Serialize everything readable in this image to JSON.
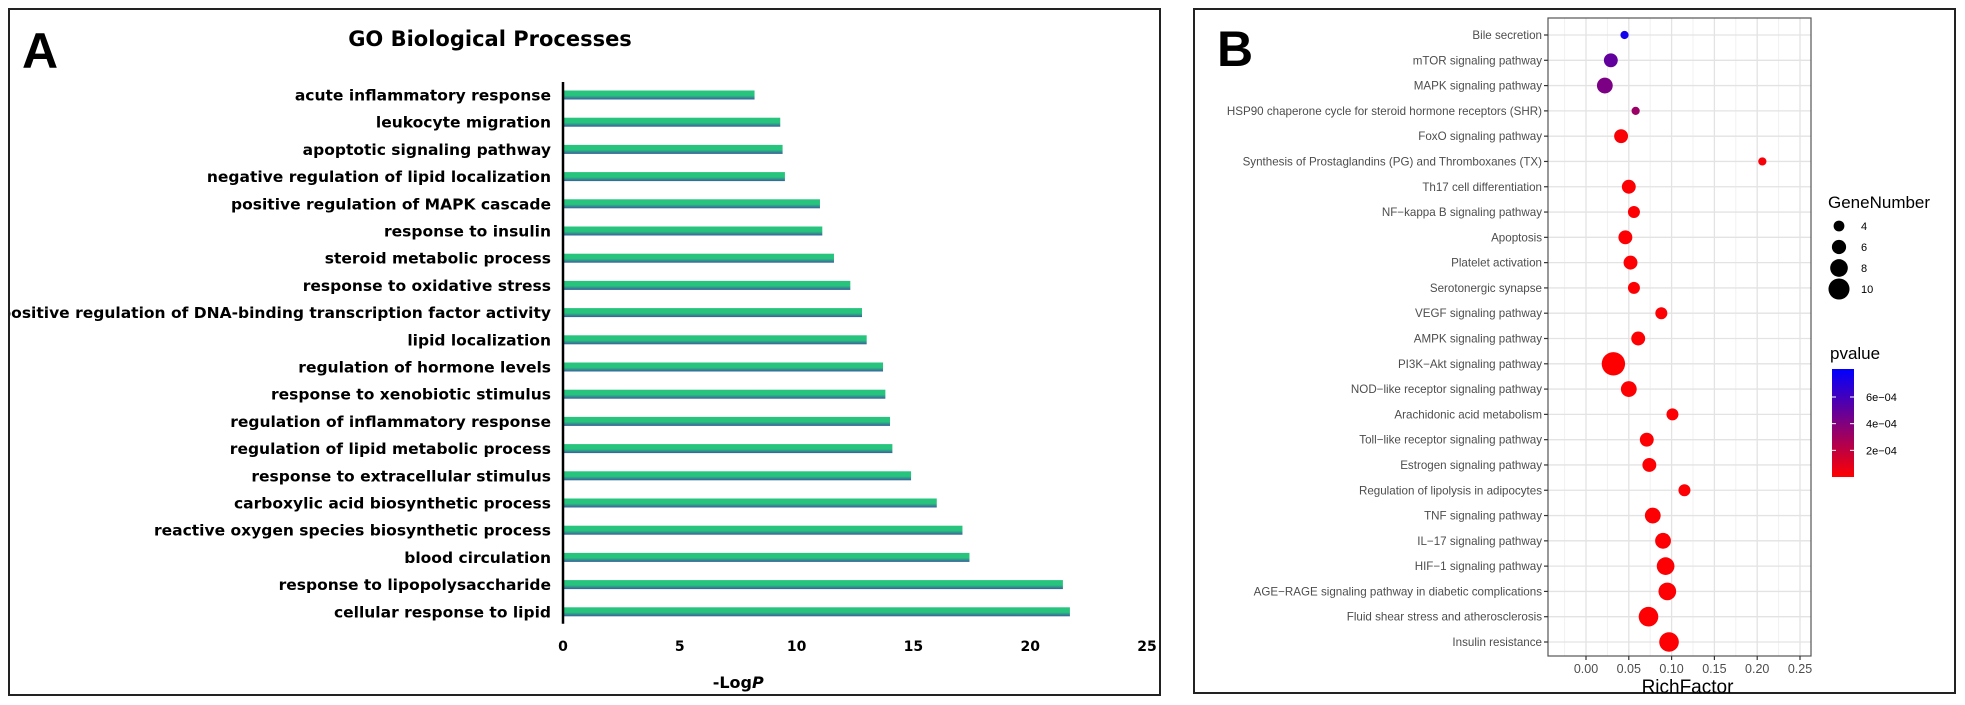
{
  "panel_a": {
    "letter": "A",
    "chart_data": {
      "type": "bar",
      "orientation": "horizontal",
      "title": "GO Biological Processes",
      "xlabel_prefix": "-Log",
      "xlabel_italic": "P",
      "ylabel": "",
      "xlim": [
        0,
        25
      ],
      "xticks": [
        "0",
        "5",
        "10",
        "15",
        "20",
        "25"
      ],
      "categories": [
        "acute inflammatory response",
        "leukocyte migration",
        "apoptotic signaling pathway",
        "negative regulation of lipid localization",
        "positive regulation of MAPK cascade",
        "response to insulin",
        "steroid metabolic process",
        "response to oxidative stress",
        "positive regulation of DNA-binding transcription factor activity",
        "lipid localization",
        "regulation of hormone levels",
        "response to xenobiotic stimulus",
        "regulation of inflammatory response",
        "regulation of lipid metabolic process",
        "response to extracellular stimulus",
        "carboxylic acid biosynthetic process",
        "reactive oxygen species biosynthetic process",
        "blood circulation",
        "response to lipopolysaccharide",
        "cellular response to lipid"
      ],
      "values": [
        8.2,
        9.3,
        9.4,
        9.5,
        11.0,
        11.1,
        11.6,
        12.3,
        12.8,
        13.0,
        13.7,
        13.8,
        14.0,
        14.1,
        14.9,
        16.0,
        17.1,
        17.4,
        21.4,
        21.7
      ],
      "bar_color_top": "#27c47d",
      "bar_color_bottom": "#3a5d9c",
      "grid": false
    }
  },
  "panel_b": {
    "letter": "B",
    "chart_data": {
      "type": "scatter",
      "xlabel": "RichFactor",
      "ylabel": "",
      "xlim": [
        -0.04,
        0.262
      ],
      "xticks": [
        "0.00",
        "0.05",
        "0.10",
        "0.15",
        "0.20",
        "0.25"
      ],
      "xtick_values": [
        0.0,
        0.05,
        0.1,
        0.15,
        0.2,
        0.25
      ],
      "grid": true,
      "categories": [
        "Bile secretion",
        "mTOR signaling pathway",
        "MAPK signaling pathway",
        "HSP90 chaperone cycle for steroid hormone receptors (SHR)",
        "FoxO signaling pathway",
        "Synthesis of Prostaglandins (PG) and Thromboxanes (TX)",
        "Th17 cell differentiation",
        "NF−kappa B signaling pathway",
        "Apoptosis",
        "Platelet activation",
        "Serotonergic synapse",
        "VEGF signaling pathway",
        "AMPK signaling pathway",
        "PI3K−Akt signaling pathway",
        "NOD−like receptor signaling pathway",
        "Arachidonic acid metabolism",
        "Toll−like receptor signaling pathway",
        "Estrogen signaling pathway",
        "Regulation of lipolysis in adipocytes",
        "TNF signaling pathway",
        "IL−17 signaling pathway",
        "HIF−1 signaling pathway",
        "AGE−RAGE signaling pathway in diabetic complications",
        "Fluid shear stress and atherosclerosis",
        "Insulin resistance"
      ],
      "rich_factor": [
        0.045,
        0.029,
        0.022,
        0.058,
        0.041,
        0.206,
        0.05,
        0.056,
        0.046,
        0.052,
        0.056,
        0.088,
        0.061,
        0.032,
        0.05,
        0.101,
        0.071,
        0.074,
        0.115,
        0.078,
        0.09,
        0.093,
        0.095,
        0.073,
        0.097
      ],
      "gene_number": [
        2,
        5,
        6,
        2,
        5,
        2,
        5,
        4,
        5,
        5,
        4,
        4,
        5,
        10,
        6,
        4,
        5,
        5,
        4,
        6,
        6,
        7,
        7,
        8,
        8
      ],
      "pvalue": [
        0.00075,
        0.0005,
        0.00042,
        0.00032,
        2e-05,
        3e-05,
        1e-05,
        1e-05,
        1e-05,
        1e-05,
        1e-05,
        1e-05,
        1e-05,
        1e-06,
        1e-05,
        1e-05,
        1e-05,
        1e-05,
        1e-05,
        1e-05,
        1e-05,
        1e-05,
        1e-05,
        1e-05,
        1e-05
      ],
      "legend": {
        "size_title": "GeneNumber",
        "size_entries": [
          "4",
          "6",
          "8",
          "10"
        ],
        "size_values": [
          4,
          6,
          8,
          10
        ],
        "color_title": "pvalue",
        "color_ticks": [
          "6e−04",
          "4e−04",
          "2e−04"
        ],
        "color_tick_values": [
          0.0006,
          0.0004,
          0.0002
        ],
        "color_range": [
          0,
          0.00081
        ],
        "color_low": "#ff0000",
        "color_high": "#0000ff",
        "placement": "right"
      }
    }
  }
}
